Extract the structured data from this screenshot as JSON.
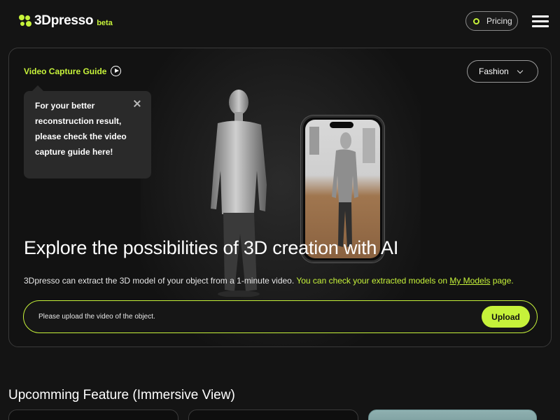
{
  "header": {
    "logo_name": "3Dpresso",
    "logo_badge": "beta",
    "pricing_label": "Pricing",
    "menu_icon": "hamburger-icon"
  },
  "hero": {
    "guide_link": "Video Capture Guide",
    "guide_icon": "play-circle-icon",
    "tooltip_text": "For your better reconstruction result, please check the video capture guide here!",
    "category_selected": "Fashion",
    "title": "Explore the possibilities of 3D creation with AI",
    "desc_plain": "3Dpresso can extract the 3D model of your object from a 1-minute video. ",
    "desc_highlight": "You can check your extracted models on ",
    "desc_link": "My Models",
    "desc_suffix": " page.",
    "upload_placeholder": "Please upload the video of the object.",
    "upload_button": "Upload"
  },
  "upcoming": {
    "title": "Upcomming Feature (Immersive View)"
  },
  "colors": {
    "accent": "#c6f23a",
    "background": "#141414",
    "panel": "#2a2a2a"
  }
}
